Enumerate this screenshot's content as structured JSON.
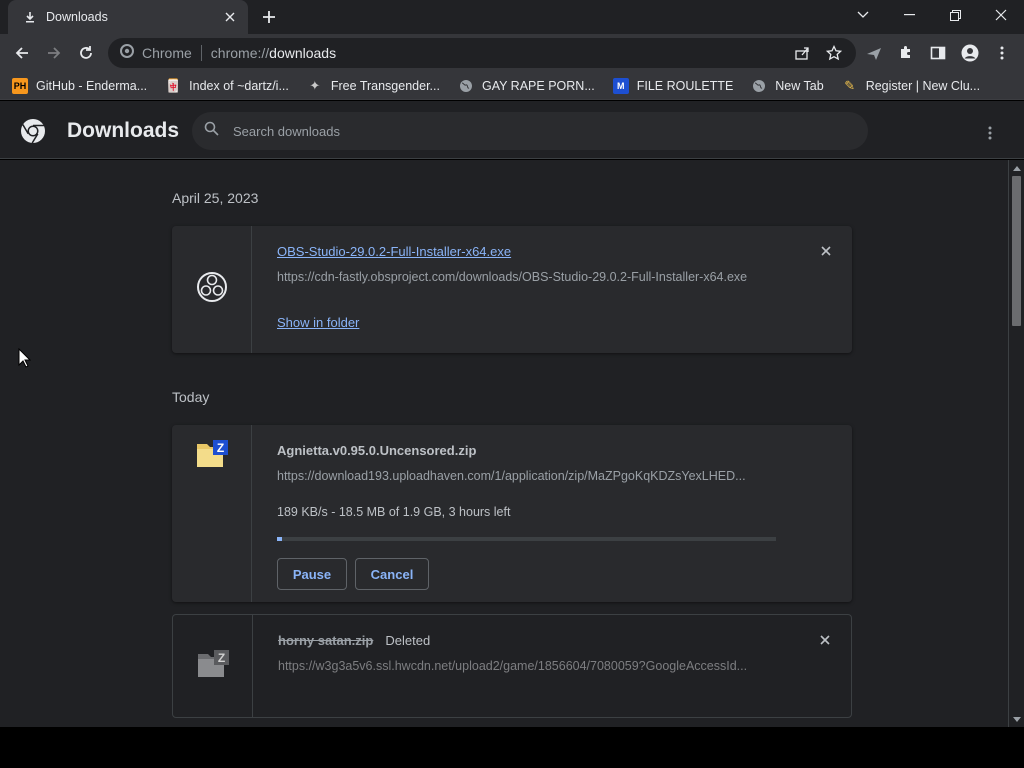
{
  "tab": {
    "title": "Downloads"
  },
  "omnibox": {
    "chip": "Chrome",
    "url_prefix": "chrome://",
    "url_host": "downloads"
  },
  "bookmarks": [
    {
      "label": "GitHub - Enderma...",
      "icon": "PH"
    },
    {
      "label": "Index of ~dartz/i...",
      "icon": "🀄"
    },
    {
      "label": "Free Transgender...",
      "icon": "✦"
    },
    {
      "label": "GAY RAPE PORN...",
      "icon": "🌐"
    },
    {
      "label": "FILE ROULETTE",
      "icon": "M"
    },
    {
      "label": "New Tab",
      "icon": "🌐"
    },
    {
      "label": "Register | New Clu...",
      "icon": "✎"
    }
  ],
  "header": {
    "title": "Downloads",
    "search_placeholder": "Search downloads"
  },
  "groups": [
    {
      "date": "April 25, 2023",
      "items": [
        {
          "filename": "OBS-Studio-29.0.2-Full-Installer-x64.exe",
          "url": "https://cdn-fastly.obsproject.com/downloads/OBS-Studio-29.0.2-Full-Installer-x64.exe",
          "action": "Show in folder"
        }
      ]
    },
    {
      "date": "Today",
      "items": [
        {
          "filename": "Agnietta.v0.95.0.Uncensored.zip",
          "url": "https://download193.uploadhaven.com/1/application/zip/MaZPgoKqKDZsYexLHED...",
          "status": "189 KB/s - 18.5 MB of 1.9 GB, 3 hours left",
          "progress": 0.01,
          "pause_label": "Pause",
          "cancel_label": "Cancel"
        },
        {
          "filename": "horny satan.zip",
          "tag": "Deleted",
          "url": "https://w3g3a5v6.ssl.hwcdn.net/upload2/game/1856604/7080059?GoogleAccessId..."
        }
      ]
    }
  ],
  "colors": {
    "accent": "#8ab4f8",
    "background": "#202124",
    "card": "#292a2d"
  }
}
